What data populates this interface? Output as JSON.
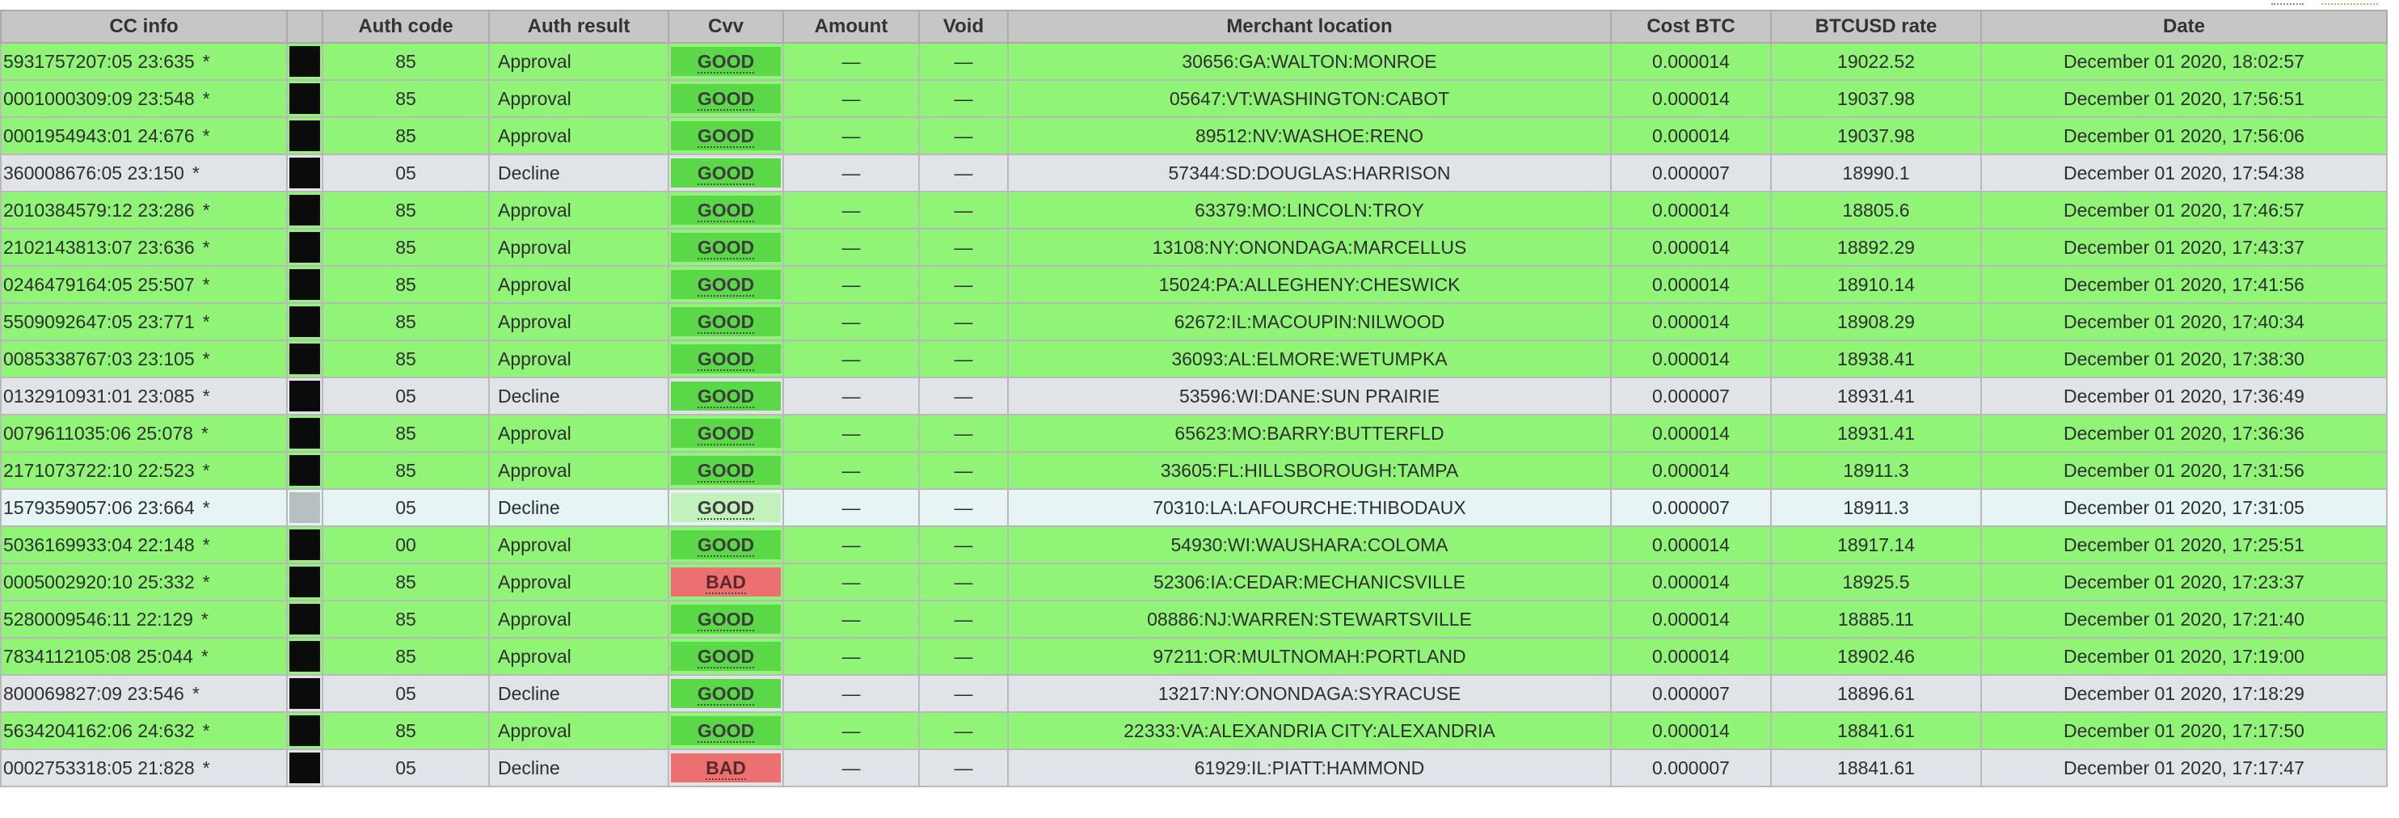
{
  "table": {
    "columns": [
      "CC info",
      "",
      "Auth code",
      "Auth result",
      "Cvv",
      "Amount",
      "Void",
      "Merchant location",
      "Cost BTC",
      "BTCUSD rate",
      "Date"
    ],
    "rows": [
      {
        "cc": "5931757207:05 23:635",
        "auth_code": "85",
        "auth_result": "Approval",
        "cvv": "GOOD",
        "amount": "—",
        "void": "—",
        "location": "30656:GA:WALTON:MONROE",
        "cost_btc": "0.000014",
        "rate": "19022.52",
        "date": "December 01 2020, 18:02:57"
      },
      {
        "cc": "0001000309:09 23:548",
        "auth_code": "85",
        "auth_result": "Approval",
        "cvv": "GOOD",
        "amount": "—",
        "void": "—",
        "location": "05647:VT:WASHINGTON:CABOT",
        "cost_btc": "0.000014",
        "rate": "19037.98",
        "date": "December 01 2020, 17:56:51"
      },
      {
        "cc": "0001954943:01 24:676",
        "auth_code": "85",
        "auth_result": "Approval",
        "cvv": "GOOD",
        "amount": "—",
        "void": "—",
        "location": "89512:NV:WASHOE:RENO",
        "cost_btc": "0.000014",
        "rate": "19037.98",
        "date": "December 01 2020, 17:56:06"
      },
      {
        "cc": "360008676:05 23:150",
        "auth_code": "05",
        "auth_result": "Decline",
        "cvv": "GOOD",
        "amount": "—",
        "void": "—",
        "location": "57344:SD:DOUGLAS:HARRISON",
        "cost_btc": "0.000007",
        "rate": "18990.1",
        "date": "December 01 2020, 17:54:38"
      },
      {
        "cc": "2010384579:12 23:286",
        "auth_code": "85",
        "auth_result": "Approval",
        "cvv": "GOOD",
        "amount": "—",
        "void": "—",
        "location": "63379:MO:LINCOLN:TROY",
        "cost_btc": "0.000014",
        "rate": "18805.6",
        "date": "December 01 2020, 17:46:57"
      },
      {
        "cc": "2102143813:07 23:636",
        "auth_code": "85",
        "auth_result": "Approval",
        "cvv": "GOOD",
        "amount": "—",
        "void": "—",
        "location": "13108:NY:ONONDAGA:MARCELLUS",
        "cost_btc": "0.000014",
        "rate": "18892.29",
        "date": "December 01 2020, 17:43:37"
      },
      {
        "cc": "0246479164:05 25:507",
        "auth_code": "85",
        "auth_result": "Approval",
        "cvv": "GOOD",
        "amount": "—",
        "void": "—",
        "location": "15024:PA:ALLEGHENY:CHESWICK",
        "cost_btc": "0.000014",
        "rate": "18910.14",
        "date": "December 01 2020, 17:41:56"
      },
      {
        "cc": "5509092647:05 23:771",
        "auth_code": "85",
        "auth_result": "Approval",
        "cvv": "GOOD",
        "amount": "—",
        "void": "—",
        "location": "62672:IL:MACOUPIN:NILWOOD",
        "cost_btc": "0.000014",
        "rate": "18908.29",
        "date": "December 01 2020, 17:40:34"
      },
      {
        "cc": "0085338767:03 23:105",
        "auth_code": "85",
        "auth_result": "Approval",
        "cvv": "GOOD",
        "amount": "—",
        "void": "—",
        "location": "36093:AL:ELMORE:WETUMPKA",
        "cost_btc": "0.000014",
        "rate": "18938.41",
        "date": "December 01 2020, 17:38:30"
      },
      {
        "cc": "0132910931:01 23:085",
        "auth_code": "05",
        "auth_result": "Decline",
        "cvv": "GOOD",
        "amount": "—",
        "void": "—",
        "location": "53596:WI:DANE:SUN PRAIRIE",
        "cost_btc": "0.000007",
        "rate": "18931.41",
        "date": "December 01 2020, 17:36:49"
      },
      {
        "cc": "0079611035:06 25:078",
        "auth_code": "85",
        "auth_result": "Approval",
        "cvv": "GOOD",
        "amount": "—",
        "void": "—",
        "location": "65623:MO:BARRY:BUTTERFLD",
        "cost_btc": "0.000014",
        "rate": "18931.41",
        "date": "December 01 2020, 17:36:36"
      },
      {
        "cc": "2171073722:10 22:523",
        "auth_code": "85",
        "auth_result": "Approval",
        "cvv": "GOOD",
        "amount": "—",
        "void": "—",
        "location": "33605:FL:HILLSBOROUGH:TAMPA",
        "cost_btc": "0.000014",
        "rate": "18911.3",
        "date": "December 01 2020, 17:31:56"
      },
      {
        "cc": "1579359057:06 23:664",
        "auth_code": "05",
        "auth_result": "Decline",
        "cvv": "GOOD",
        "amount": "—",
        "void": "—",
        "location": "70310:LA:LAFOURCHE:THIBODAUX",
        "cost_btc": "0.000007",
        "rate": "18911.3",
        "date": "December 01 2020, 17:31:05"
      },
      {
        "cc": "5036169933:04 22:148",
        "auth_code": "00",
        "auth_result": "Approval",
        "cvv": "GOOD",
        "amount": "—",
        "void": "—",
        "location": "54930:WI:WAUSHARA:COLOMA",
        "cost_btc": "0.000014",
        "rate": "18917.14",
        "date": "December 01 2020, 17:25:51"
      },
      {
        "cc": "0005002920:10 25:332",
        "auth_code": "85",
        "auth_result": "Approval",
        "cvv": "BAD",
        "amount": "—",
        "void": "—",
        "location": "52306:IA:CEDAR:MECHANICSVILLE",
        "cost_btc": "0.000014",
        "rate": "18925.5",
        "date": "December 01 2020, 17:23:37"
      },
      {
        "cc": "5280009546:11 22:129",
        "auth_code": "85",
        "auth_result": "Approval",
        "cvv": "GOOD",
        "amount": "—",
        "void": "—",
        "location": "08886:NJ:WARREN:STEWARTSVILLE",
        "cost_btc": "0.000014",
        "rate": "18885.11",
        "date": "December 01 2020, 17:21:40"
      },
      {
        "cc": "7834112105:08 25:044",
        "auth_code": "85",
        "auth_result": "Approval",
        "cvv": "GOOD",
        "amount": "—",
        "void": "—",
        "location": "97211:OR:MULTNOMAH:PORTLAND",
        "cost_btc": "0.000014",
        "rate": "18902.46",
        "date": "December 01 2020, 17:19:00"
      },
      {
        "cc": "800069827:09 23:546",
        "auth_code": "05",
        "auth_result": "Decline",
        "cvv": "GOOD",
        "amount": "—",
        "void": "—",
        "location": "13217:NY:ONONDAGA:SYRACUSE",
        "cost_btc": "0.000007",
        "rate": "18896.61",
        "date": "December 01 2020, 17:18:29"
      },
      {
        "cc": "5634204162:06 24:632",
        "auth_code": "85",
        "auth_result": "Approval",
        "cvv": "GOOD",
        "amount": "—",
        "void": "—",
        "location": "22333:VA:ALEXANDRIA CITY:ALEXANDRIA",
        "cost_btc": "0.000014",
        "rate": "18841.61",
        "date": "December 01 2020, 17:17:50"
      },
      {
        "cc": "0002753318:05 21:828",
        "auth_code": "05",
        "auth_result": "Decline",
        "cvv": "BAD",
        "amount": "—",
        "void": "—",
        "location": "61929:IL:PIATT:HAMMOND",
        "cost_btc": "0.000007",
        "rate": "18841.61",
        "date": "December 01 2020, 17:17:47"
      }
    ],
    "star": "*",
    "selected_row": 12
  },
  "colors": {
    "approval_row": "#90f577",
    "decline_row": "#e0e4e8",
    "selected_row": "#e6f5f4",
    "cvv_good": "#5bd848",
    "cvv_bad": "#ec7070",
    "header_bg": "#c6c6c6"
  },
  "icons": {
    "row_marker": "card-swatch"
  }
}
